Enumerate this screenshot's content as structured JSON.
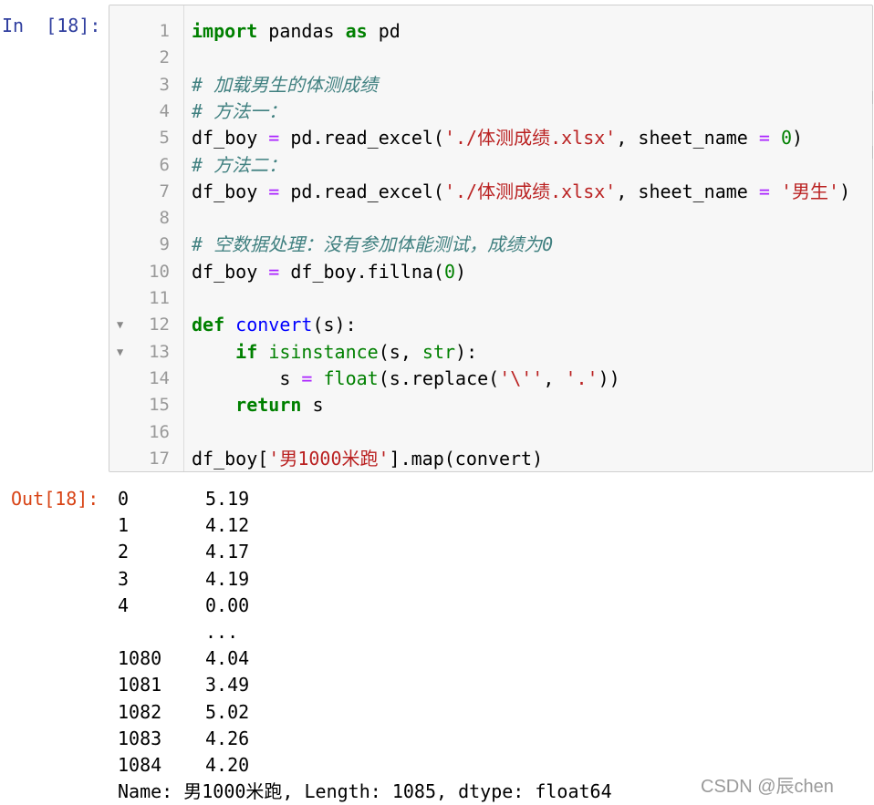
{
  "cell": {
    "in_prompt": "In  [18]:",
    "out_prompt": "Out[18]:",
    "lines": [
      {
        "n": "1",
        "fold": false,
        "tokens": [
          {
            "t": "import",
            "c": "kw"
          },
          {
            "t": " pandas "
          },
          {
            "t": "as",
            "c": "kw"
          },
          {
            "t": " pd"
          }
        ]
      },
      {
        "n": "2",
        "fold": false,
        "tokens": []
      },
      {
        "n": "3",
        "fold": false,
        "tokens": [
          {
            "t": "# 加载男生的体测成绩",
            "c": "cm"
          }
        ]
      },
      {
        "n": "4",
        "fold": false,
        "tokens": [
          {
            "t": "# 方法一：",
            "c": "cm"
          }
        ]
      },
      {
        "n": "5",
        "fold": false,
        "tokens": [
          {
            "t": "df_boy "
          },
          {
            "t": "=",
            "c": "op"
          },
          {
            "t": " pd.read_excel("
          },
          {
            "t": "'./体测成绩.xlsx'",
            "c": "st"
          },
          {
            "t": ", sheet_name "
          },
          {
            "t": "=",
            "c": "op"
          },
          {
            "t": " "
          },
          {
            "t": "0",
            "c": "nm"
          },
          {
            "t": ")"
          }
        ]
      },
      {
        "n": "6",
        "fold": false,
        "tokens": [
          {
            "t": "# 方法二：",
            "c": "cm"
          }
        ]
      },
      {
        "n": "7",
        "fold": false,
        "tokens": [
          {
            "t": "df_boy "
          },
          {
            "t": "=",
            "c": "op"
          },
          {
            "t": " pd.read_excel("
          },
          {
            "t": "'./体测成绩.xlsx'",
            "c": "st"
          },
          {
            "t": ", sheet_name "
          },
          {
            "t": "=",
            "c": "op"
          },
          {
            "t": " "
          },
          {
            "t": "'男生'",
            "c": "st"
          },
          {
            "t": ")"
          }
        ]
      },
      {
        "n": "8",
        "fold": false,
        "tokens": []
      },
      {
        "n": "9",
        "fold": false,
        "tokens": [
          {
            "t": "# 空数据处理：没有参加体能测试，成绩为0",
            "c": "cm"
          }
        ]
      },
      {
        "n": "10",
        "fold": false,
        "tokens": [
          {
            "t": "df_boy "
          },
          {
            "t": "=",
            "c": "op"
          },
          {
            "t": " df_boy.fillna("
          },
          {
            "t": "0",
            "c": "nm"
          },
          {
            "t": ")"
          }
        ]
      },
      {
        "n": "11",
        "fold": false,
        "tokens": []
      },
      {
        "n": "12",
        "fold": true,
        "tokens": [
          {
            "t": "def",
            "c": "kw"
          },
          {
            "t": " "
          },
          {
            "t": "convert",
            "c": "fn"
          },
          {
            "t": "(s):"
          }
        ]
      },
      {
        "n": "13",
        "fold": true,
        "tokens": [
          {
            "t": "    "
          },
          {
            "t": "if",
            "c": "kw"
          },
          {
            "t": " "
          },
          {
            "t": "isinstance",
            "c": "bi"
          },
          {
            "t": "(s, "
          },
          {
            "t": "str",
            "c": "bi"
          },
          {
            "t": "):"
          }
        ]
      },
      {
        "n": "14",
        "fold": false,
        "tokens": [
          {
            "t": "        s "
          },
          {
            "t": "=",
            "c": "op"
          },
          {
            "t": " "
          },
          {
            "t": "float",
            "c": "bi"
          },
          {
            "t": "(s.replace("
          },
          {
            "t": "'\\''",
            "c": "st"
          },
          {
            "t": ", "
          },
          {
            "t": "'.'",
            "c": "st"
          },
          {
            "t": "))"
          }
        ]
      },
      {
        "n": "15",
        "fold": false,
        "tokens": [
          {
            "t": "    "
          },
          {
            "t": "return",
            "c": "kw"
          },
          {
            "t": " s"
          }
        ]
      },
      {
        "n": "16",
        "fold": false,
        "tokens": []
      },
      {
        "n": "17",
        "fold": false,
        "tokens": [
          {
            "t": "df_boy["
          },
          {
            "t": "'男1000米跑'",
            "c": "st"
          },
          {
            "t": "].map(convert)"
          }
        ]
      }
    ]
  },
  "output": {
    "rows": [
      {
        "index": "0",
        "value": "5.19"
      },
      {
        "index": "1",
        "value": "4.12"
      },
      {
        "index": "2",
        "value": "4.17"
      },
      {
        "index": "3",
        "value": "4.19"
      },
      {
        "index": "4",
        "value": "0.00"
      },
      {
        "index": "",
        "value": "..."
      },
      {
        "index": "1080",
        "value": "4.04"
      },
      {
        "index": "1081",
        "value": "3.49"
      },
      {
        "index": "1082",
        "value": "5.02"
      },
      {
        "index": "1083",
        "value": "4.26"
      },
      {
        "index": "1084",
        "value": "4.20"
      }
    ],
    "footer": "Name: 男1000米跑, Length: 1085, dtype: float64"
  },
  "watermark": "CSDN @辰chen",
  "colors": {
    "prompt_in": "#303f9f",
    "prompt_out": "#d84315",
    "keyword": "#008000",
    "comment": "#408080",
    "string": "#ba2121",
    "operator": "#aa22ff",
    "function": "#0000ff"
  }
}
